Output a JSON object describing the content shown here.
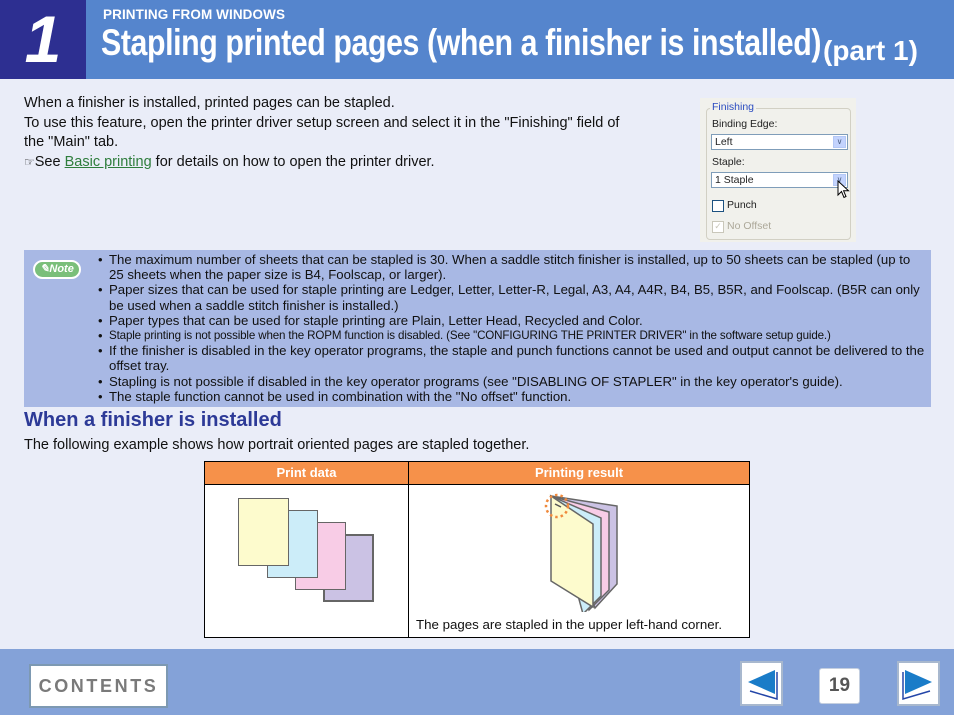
{
  "header": {
    "chapter_number": "1",
    "section_label": "PRINTING FROM WINDOWS",
    "title": "Stapling printed pages (when a finisher is installed)",
    "part_label": "(part 1)"
  },
  "intro": {
    "line1": "When a finisher is installed, printed pages can be stapled.",
    "line2": "To use this feature, open the printer driver setup screen and select it in the \"Finishing\" field of the \"Main\" tab.",
    "ref_icon": "☞",
    "ref_prefix": "See ",
    "ref_link": "Basic printing",
    "ref_suffix": " for details on how to open the printer driver."
  },
  "finishing_dialog": {
    "group_label": "Finishing",
    "binding_edge_label": "Binding Edge:",
    "binding_edge_value": "Left",
    "staple_label": "Staple:",
    "staple_value": "1 Staple",
    "punch_label": "Punch",
    "punch_checked": false,
    "no_offset_label": "No Offset",
    "no_offset_checked": true,
    "no_offset_disabled": true
  },
  "note": {
    "badge": "Note",
    "items": [
      "The maximum number of sheets that can be stapled is 30. When a saddle stitch finisher is installed, up to 50 sheets can be stapled (up to 25 sheets when the paper size is B4, Foolscap, or larger).",
      "Paper sizes that can be used for staple printing are Ledger, Letter, Letter-R, Legal, A3, A4, A4R, B4, B5, B5R, and Foolscap. (B5R can only be used when a saddle stitch finisher is installed.)",
      "Paper types that can be used for staple printing are Plain, Letter Head, Recycled and Color.",
      "Staple printing is not possible when the ROPM function is disabled. (See \"CONFIGURING THE PRINTER DRIVER\" in the software setup guide.)",
      "If the finisher is disabled in the key operator programs, the staple and punch functions cannot be used and output cannot be delivered to the offset tray.",
      "Stapling is not possible if disabled in the key operator programs (see \"DISABLING OF STAPLER\" in the key operator's guide).",
      "The staple function cannot be used in combination with the \"No offset\" function."
    ]
  },
  "section": {
    "heading": "When a finisher is installed",
    "description": "The following example shows how portrait oriented pages are stapled together."
  },
  "example_table": {
    "headers": [
      "Print data",
      "Printing result"
    ],
    "result_caption": "The pages are stapled in the upper left-hand corner.",
    "page_colors": [
      "#fdfbcd",
      "#ccedf9",
      "#f8cce6",
      "#cbc2e4"
    ],
    "header_color": "#f6914a"
  },
  "footer": {
    "contents_label": "CONTENTS",
    "page_number": "19",
    "prev_icon": "previous-page-arrow",
    "next_icon": "next-page-arrow"
  }
}
